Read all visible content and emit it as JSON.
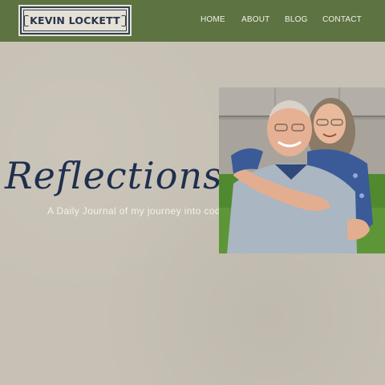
{
  "header": {
    "logo_text": "KEVIN LOCKETT",
    "bg_color": "#5d7442",
    "nav": [
      "HOME",
      "ABOUT",
      "BLOG",
      "CONTACT"
    ]
  },
  "hero": {
    "title": "Reflections",
    "subtitle": "A Daily Journal of my journey into coding"
  }
}
